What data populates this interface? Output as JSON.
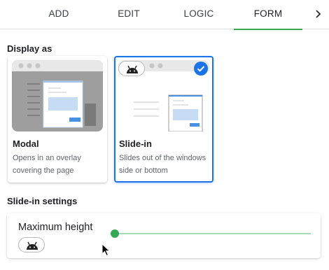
{
  "tabs": [
    {
      "label": "ADD"
    },
    {
      "label": "EDIT"
    },
    {
      "label": "LOGIC"
    },
    {
      "label": "FORM",
      "active": true
    }
  ],
  "tab_next_icon": "chevron-right-icon",
  "display_as": {
    "label": "Display as",
    "selected": "slide-in",
    "options": [
      {
        "title": "Modal",
        "description": "Opens in an overlay covering the page"
      },
      {
        "title": "Slide-in",
        "description": "Slides out of the windows side or bottom"
      }
    ]
  },
  "slide_in_settings": {
    "label": "Slide-in settings",
    "maximum_height_label": "Maximum height",
    "slider_value_fraction": 0.0
  },
  "colors": {
    "accent_green": "#34a853",
    "slider_track": "#a8dab5",
    "selected_border": "#1a73e8",
    "thumb_gray": "#9e9e9e",
    "preview_blue": "#c6dcf5"
  }
}
